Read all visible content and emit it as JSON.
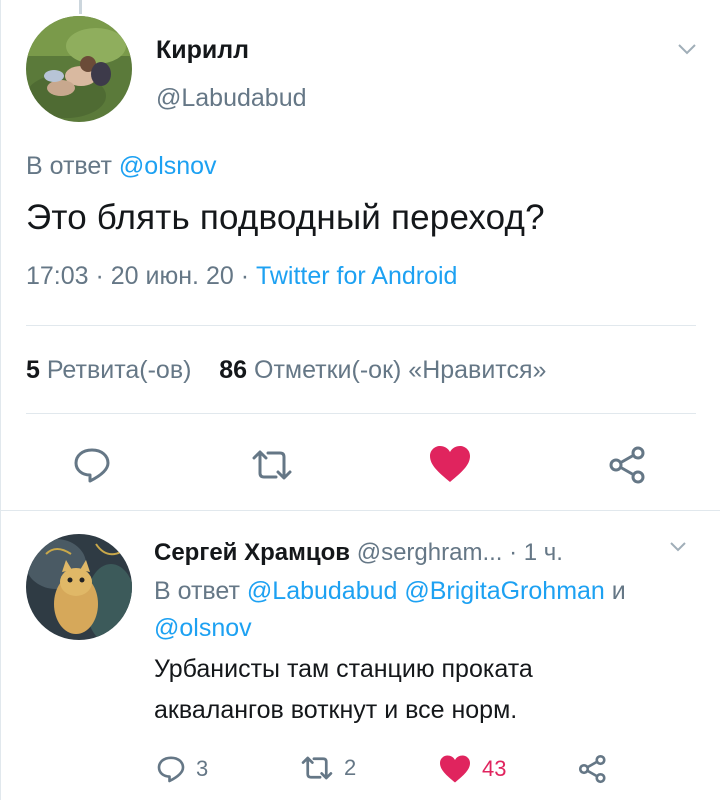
{
  "main_tweet": {
    "author_name": "Кирилл",
    "author_handle": "@Labudabud",
    "reply_prefix": "В ответ",
    "reply_to": "@olsnov",
    "text": "Это блять подводный переход?",
    "time": "17:03",
    "date": "20 июн. 20",
    "source": "Twitter for Android",
    "sep": " · ",
    "retweets_count": "5",
    "retweets_label": "Ретвита(-ов)",
    "likes_count": "86",
    "likes_label": "Отметки(-ок) «Нравится»",
    "liked": true,
    "icons": [
      "reply-icon",
      "retweet-icon",
      "like-icon",
      "share-icon"
    ]
  },
  "reply_tweet": {
    "author_name": "Сергей Храмцов",
    "author_handle": "@serghram...",
    "time_sep": " · ",
    "time": "1 ч.",
    "reply_prefix": "В ответ",
    "reply_to_1": "@Labudabud",
    "reply_to_2": "@BrigitaGrohman",
    "reply_and": "и",
    "reply_to_3": "@olsnov",
    "text_line1": "Урбанисты там станцию проката",
    "text_line2": "аквалангов воткнут и все норм.",
    "reply_count": "3",
    "retweet_count": "2",
    "like_count": "43",
    "liked": true
  },
  "colors": {
    "accent": "#1da1f2",
    "like": "#e0245e",
    "secondary_text": "#657786",
    "divider": "#e1e8ed"
  }
}
